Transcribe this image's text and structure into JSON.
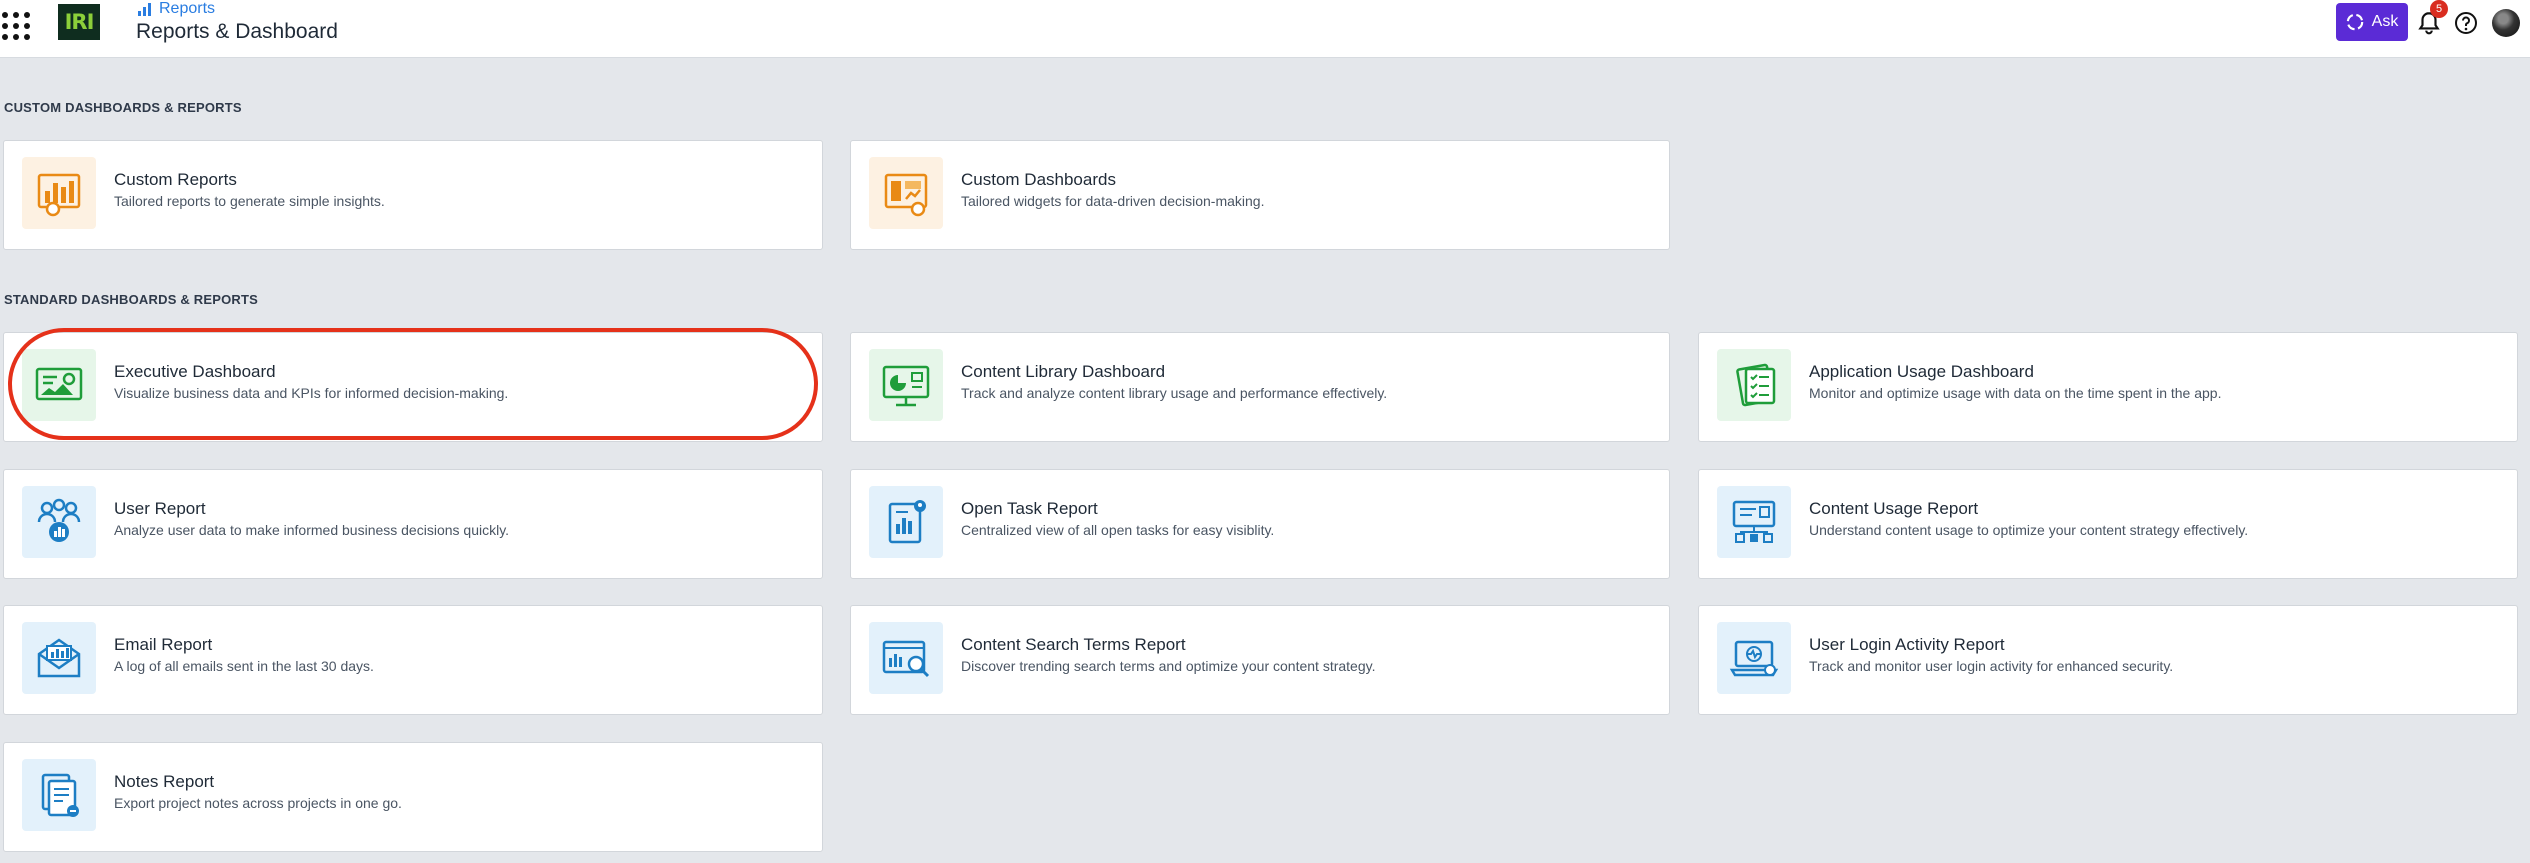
{
  "header": {
    "breadcrumb": "Reports",
    "page_title": "Reports & Dashboard",
    "logo_text": "IRI",
    "ask_label": "Ask",
    "notification_count": "5",
    "accent_color": "#5b2bd6",
    "breadcrumb_color": "#2a7de1"
  },
  "sections": {
    "custom_label": "CUSTOM DASHBOARDS & REPORTS",
    "standard_label": "STANDARD DASHBOARDS & REPORTS"
  },
  "custom_cards": [
    {
      "title": "Custom Reports",
      "desc": "Tailored reports to generate simple insights.",
      "icon": "bar-chart-gear-icon"
    },
    {
      "title": "Custom Dashboards",
      "desc": "Tailored widgets for data-driven decision-making.",
      "icon": "dashboard-widgets-icon"
    }
  ],
  "standard_cards": [
    {
      "title": "Executive Dashboard",
      "desc": "Visualize business data and KPIs for informed decision-making.",
      "icon": "kpi-screen-icon"
    },
    {
      "title": "Content Library Dashboard",
      "desc": "Track and analyze content library usage and performance effectively.",
      "icon": "monitor-pie-icon"
    },
    {
      "title": "Application Usage Dashboard",
      "desc": "Monitor and optimize usage with data on the time spent in the app.",
      "icon": "checklist-icon"
    },
    {
      "title": "User Report",
      "desc": "Analyze user data to make informed business decisions quickly.",
      "icon": "users-group-icon"
    },
    {
      "title": "Open Task Report",
      "desc": "Centralized view of all open tasks for easy visiblity.",
      "icon": "task-document-icon"
    },
    {
      "title": "Content Usage Report",
      "desc": "Understand content usage to optimize your content strategy effectively.",
      "icon": "content-hierarchy-icon"
    },
    {
      "title": "Email Report",
      "desc": "A log of all emails sent in the last 30 days.",
      "icon": "email-chart-icon"
    },
    {
      "title": "Content Search Terms Report",
      "desc": "Discover trending search terms and optimize your content strategy.",
      "icon": "search-chart-icon"
    },
    {
      "title": "User Login Activity Report",
      "desc": "Track and monitor user login activity for enhanced security.",
      "icon": "laptop-activity-icon"
    },
    {
      "title": "Notes Report",
      "desc": "Export project notes across projects in one go.",
      "icon": "notes-document-icon"
    }
  ]
}
